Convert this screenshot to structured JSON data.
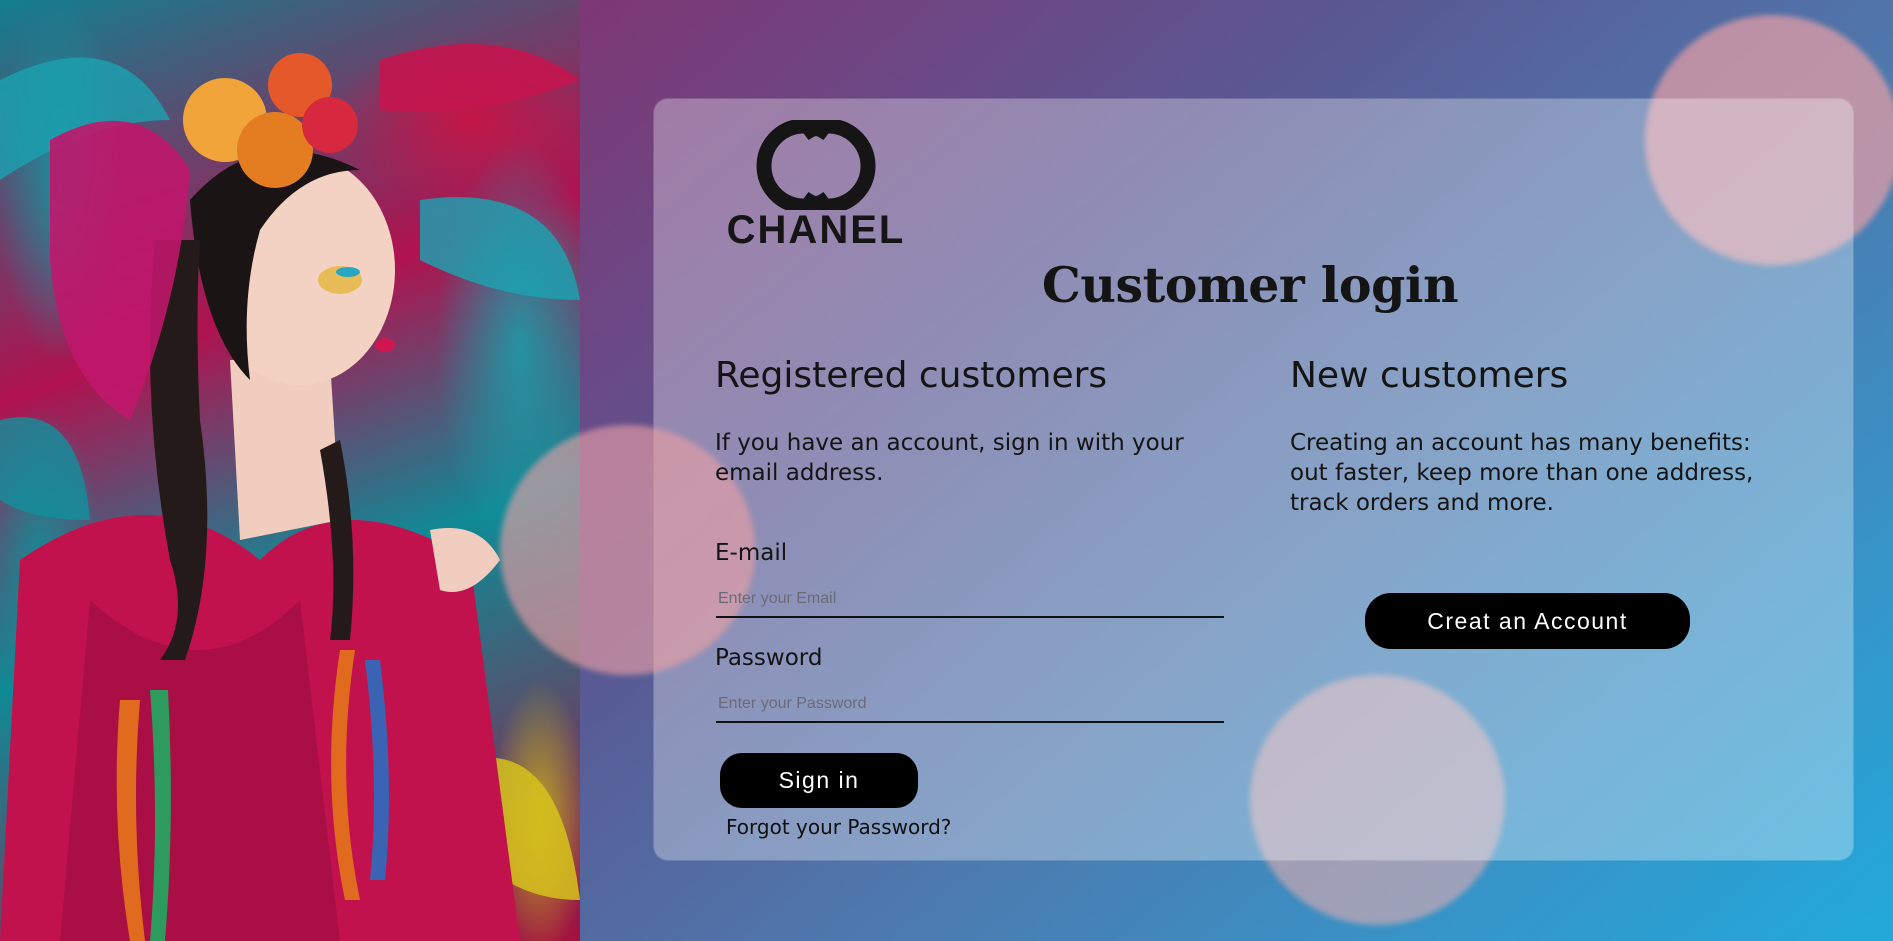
{
  "brand": {
    "name": "CHANEL"
  },
  "page": {
    "title": "Customer login"
  },
  "registered": {
    "heading": "Registered customers",
    "description": "If you have an account, sign in with your email address.",
    "email_label": "E-mail",
    "email_placeholder": "Enter your Email",
    "email_value": "",
    "password_label": "Password",
    "password_placeholder": "Enter your Password",
    "password_value": "",
    "signin_label": "Sign in",
    "forgot_label": "Forgot your Password?"
  },
  "new_customers": {
    "heading": "New customers",
    "description": "Creating an account has many benefits: out faster, keep more than one address, track orders and more.",
    "create_label": "Creat an Account"
  },
  "colors": {
    "button_bg": "#000000",
    "button_text": "#ffffff",
    "gradient_start": "#8e2561",
    "gradient_end": "#22a9db"
  }
}
